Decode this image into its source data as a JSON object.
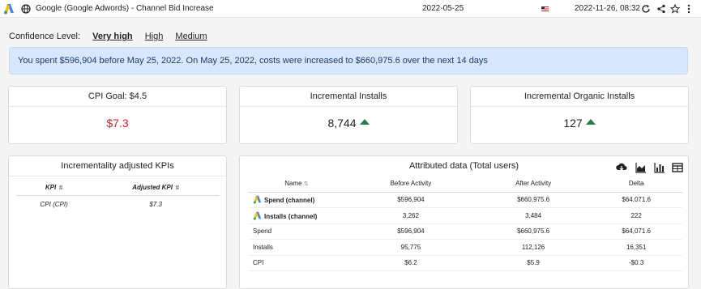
{
  "topbar": {
    "title": "Google (Google Adwords) - Channel Bid Increase",
    "date": "2022-05-25",
    "datetime": "2022-11-26, 08:32"
  },
  "confidence": {
    "label": "Confidence Level:",
    "options": [
      "Very high",
      "High",
      "Medium"
    ],
    "selected": "Very high"
  },
  "banner": "You spent $596,904 before May 25, 2022. On May 25, 2022, costs were increased to $660,975.6 over the next 14 days",
  "cards": {
    "cpi_goal": {
      "title": "CPI Goal: $4.5",
      "value": "$7.3"
    },
    "incremental_installs": {
      "title": "Incremental Installs",
      "value": "8,744"
    },
    "incremental_organic": {
      "title": "Incremental Organic Installs",
      "value": "127"
    }
  },
  "kpi_panel": {
    "title": "Incrementality adjusted KPIs",
    "headers": [
      "KPI",
      "Adjusted KPI"
    ],
    "rows": [
      [
        "CPI (CPI)",
        "$7.3"
      ]
    ]
  },
  "attr_panel": {
    "title": "Attributed data (Total users)",
    "headers": [
      "Name",
      "Before Activity",
      "After Activity",
      "Delta"
    ],
    "rows": [
      {
        "name": "Spend (channel)",
        "bold": true,
        "icon": true,
        "before": "$596,904",
        "after": "$660,975.6",
        "delta": "$64,071.6"
      },
      {
        "name": "Installs (channel)",
        "bold": true,
        "icon": true,
        "before": "3,262",
        "after": "3,484",
        "delta": "222"
      },
      {
        "name": "Spend",
        "bold": false,
        "icon": false,
        "before": "$596,904",
        "after": "$660,975.6",
        "delta": "$64,071.6"
      },
      {
        "name": "Installs",
        "bold": false,
        "icon": false,
        "before": "95,775",
        "after": "112,126",
        "delta": "16,351"
      },
      {
        "name": "CPI",
        "bold": false,
        "icon": false,
        "before": "$6.2",
        "after": "$5.9",
        "delta": "-$0.3"
      }
    ]
  },
  "colors": {
    "accent_up": "#2c7a4b",
    "bad": "#d2222d",
    "banner_bg": "#d8e7fb"
  }
}
